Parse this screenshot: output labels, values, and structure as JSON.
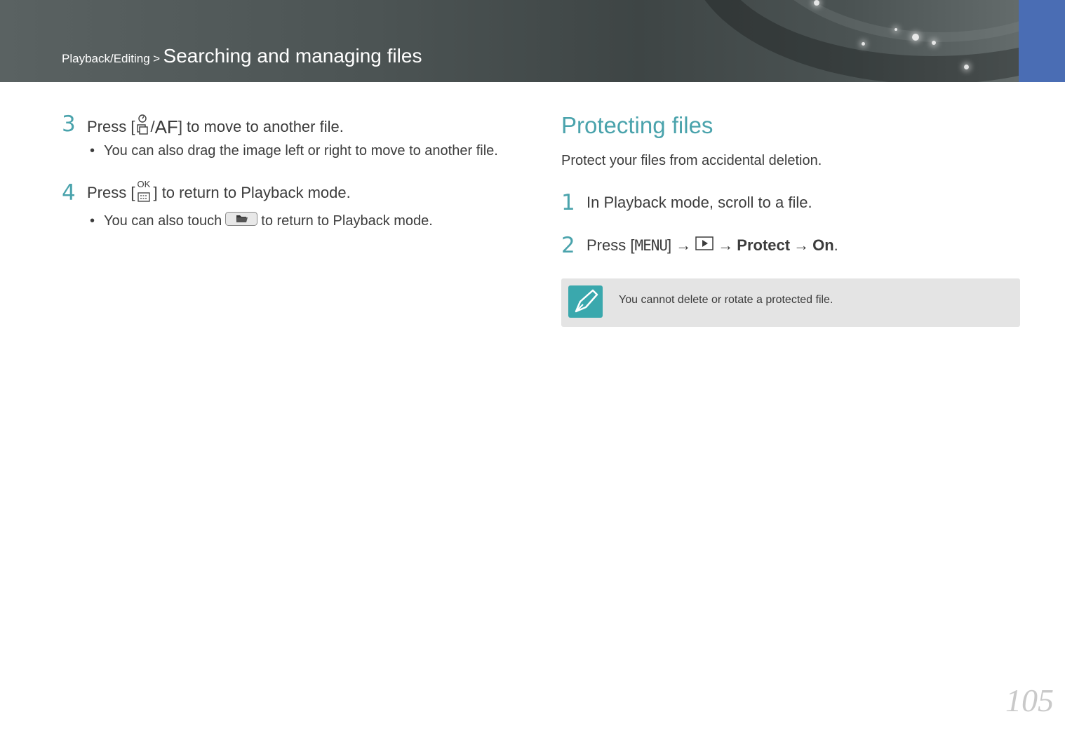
{
  "header": {
    "breadcrumb_section": "Playback/Editing",
    "breadcrumb_separator": ">",
    "breadcrumb_title": "Searching and managing files"
  },
  "left": {
    "step3": {
      "num": "3",
      "text_before": "Press [",
      "slash": "/",
      "af": "AF",
      "text_after": "] to move to another file.",
      "bullet": "You can also drag the image left or right to move to another file."
    },
    "step4": {
      "num": "4",
      "text_before": "Press [",
      "ok": "OK",
      "text_after": "] to return to Playback mode.",
      "bullet_before": "You can also touch",
      "bullet_after": "to return to Playback mode."
    }
  },
  "right": {
    "title": "Protecting files",
    "intro": "Protect your files from accidental deletion.",
    "step1": {
      "num": "1",
      "text": "In Playback mode, scroll to a file."
    },
    "step2": {
      "num": "2",
      "text_before": "Press [",
      "menu": "MENU",
      "text_mid": "] →",
      "arrow2": "→",
      "protect": "Protect",
      "arrow3": "→",
      "on": "On",
      "period": "."
    },
    "note": "You cannot delete or rotate a protected file."
  },
  "page_number": "105",
  "colors": {
    "accent": "#4aa3ac",
    "tab": "#4a6db4",
    "note_bg": "#e4e4e4"
  },
  "icons": [
    "timer-drive-icon",
    "ok-menu-icon",
    "folder-icon",
    "playback-icon",
    "note-pencil-icon"
  ]
}
